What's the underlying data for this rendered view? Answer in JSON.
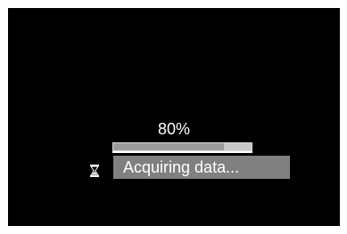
{
  "progress": {
    "percent_label": "80%",
    "value": 0.8
  },
  "status": {
    "icon": "hourglass-icon",
    "text": "Acquiring data..."
  },
  "colors": {
    "background": "#000000",
    "track": "#c8c8c8",
    "fill": "#9a9a9a",
    "status_box": "#808080",
    "text": "#ffffff"
  }
}
